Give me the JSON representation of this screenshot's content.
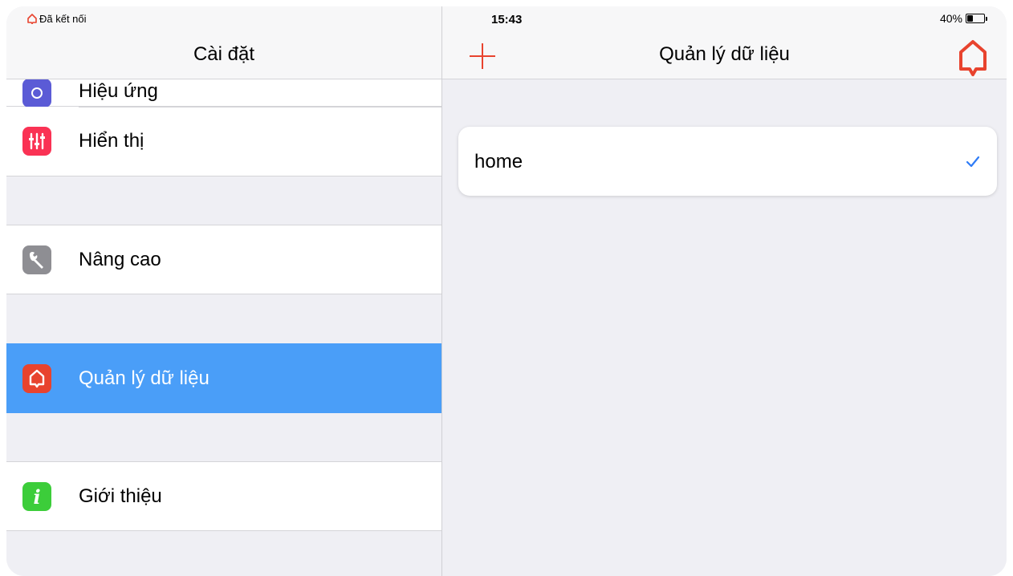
{
  "status_bar": {
    "carrier": "Đã kết nối",
    "time": "15:43",
    "battery_percent": "40%",
    "battery_level": 0.4
  },
  "colors": {
    "accent": "#e8432e",
    "selected": "#4a9ef8",
    "check": "#2f7cf6",
    "icon_effects": "#5b5bd6",
    "icon_display": "#fa3254",
    "icon_advanced": "#8e8e93",
    "icon_data": "#e8432e",
    "icon_about": "#3ccd3a"
  },
  "settings": {
    "title": "Cài đặt",
    "items": [
      {
        "label": "Hiệu ứng",
        "icon": "effects-icon"
      },
      {
        "label": "Hiển thị",
        "icon": "sliders-icon"
      },
      {
        "label": "Nâng cao",
        "icon": "wrench-icon"
      },
      {
        "label": "Quản lý dữ liệu",
        "icon": "home-icon"
      },
      {
        "label": "Giới thiệu",
        "icon": "info-icon"
      }
    ]
  },
  "detail": {
    "title": "Quản lý dữ liệu",
    "add_icon": "plus-icon",
    "home_icon": "home-icon",
    "entries": [
      {
        "name": "home",
        "selected": true
      }
    ]
  }
}
